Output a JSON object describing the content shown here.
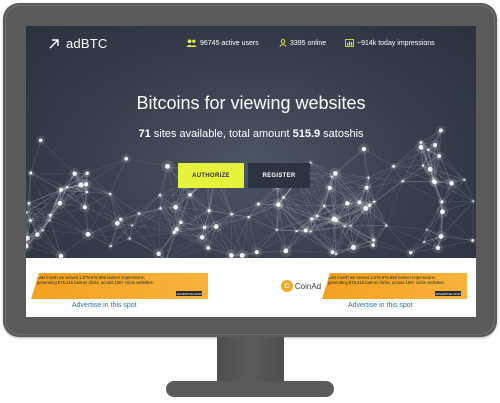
{
  "header": {
    "logo_text": "adBTC",
    "stats": [
      {
        "icon": "users-icon",
        "text": "96745 active users"
      },
      {
        "icon": "user-online-icon",
        "text": "3395 online"
      },
      {
        "icon": "chart-icon",
        "text": "~914k today impressions"
      }
    ]
  },
  "hero": {
    "title": "Bitcoins for viewing websites",
    "sites_count": "71",
    "sub_mid": " sites available, total amount ",
    "amount": "515.9",
    "sub_end": " satoshis"
  },
  "buttons": {
    "authorize": "AUTHORIZE",
    "register": "REGISTER"
  },
  "ads": {
    "brand": "CoinAd",
    "brand_mark": "C",
    "line1": "Last month we served 1,079,975,856 banner impressions,",
    "line2": "generating 875,415 banner clicks, across 100+ niche websites.",
    "cta": "ADVERTISE NOW",
    "advertise_link": "Advertise in this spot"
  },
  "colors": {
    "accent_yellow": "#e6f33c",
    "hero_bg": "#363d4b",
    "link_blue": "#2f6fb8",
    "ad_orange": "#f2a11f",
    "monitor_bezel": "#5a5a5a"
  }
}
